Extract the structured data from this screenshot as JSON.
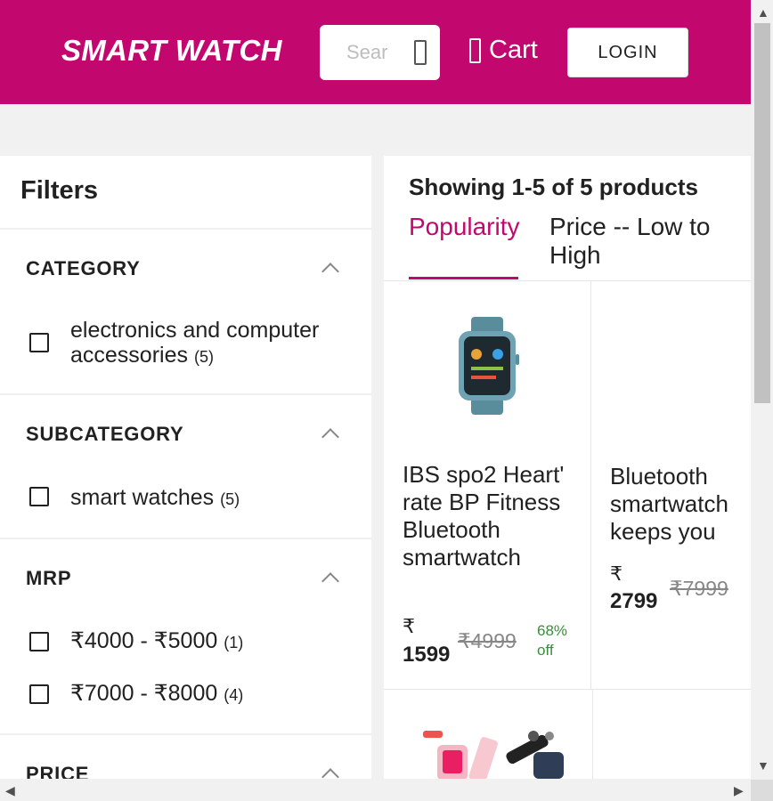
{
  "header": {
    "brand": "SMART WATCH",
    "search_placeholder": "Search",
    "cart_label": "Cart",
    "login_label": "LOGIN"
  },
  "filters": {
    "title": "Filters",
    "sections": [
      {
        "title": "CATEGORY",
        "options": [
          {
            "label": "electronics and computer accessories",
            "count": "(5)"
          }
        ]
      },
      {
        "title": "SUBCATEGORY",
        "options": [
          {
            "label": "smart watches",
            "count": "(5)"
          }
        ]
      },
      {
        "title": "MRP",
        "options": [
          {
            "label": "₹4000 - ₹5000",
            "count": "(1)"
          },
          {
            "label": "₹7000 - ₹8000",
            "count": "(4)"
          }
        ]
      },
      {
        "title": "PRICE",
        "options": []
      }
    ]
  },
  "products": {
    "summary": "Showing 1-5 of 5 products",
    "sort_tabs": [
      {
        "label": "Popularity",
        "active": true
      },
      {
        "label": "Price -- Low to High",
        "active": false
      }
    ],
    "items": [
      {
        "name": "IBS spo2 Heart' rate BP Fitness Bluetooth smartwatch",
        "currency": "₹",
        "price": "1599",
        "mrp": "₹4999",
        "discount": "68% off"
      },
      {
        "name": "Bluetooth smartwatch keeps you",
        "currency": "₹",
        "price": "2799",
        "mrp": "₹7999",
        "discount": ""
      }
    ]
  },
  "colors": {
    "brand": "#c2086f",
    "discount": "#388e3c"
  }
}
